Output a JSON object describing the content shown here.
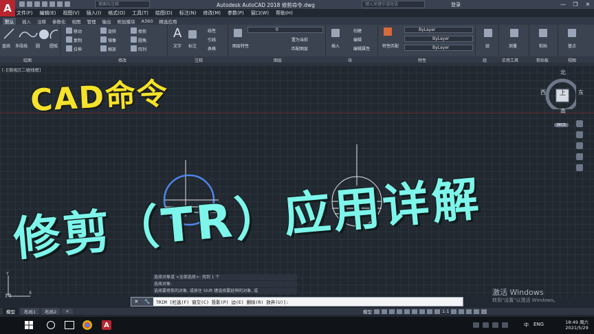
{
  "titlebar": {
    "workspace": "草图与注释",
    "title": "Autodesk AutoCAD 2018    修剪命令.dwg",
    "search_placeholder": "键入关键字或短语",
    "login": "登录",
    "min": "—",
    "max": "❐",
    "close": "✕"
  },
  "menu": [
    "文件(F)",
    "编辑(E)",
    "视图(V)",
    "插入(I)",
    "格式(O)",
    "工具(T)",
    "绘图(D)",
    "标注(N)",
    "修改(M)",
    "参数(P)",
    "窗口(W)",
    "帮助(H)"
  ],
  "ribbon_tabs": [
    "默认",
    "插入",
    "注释",
    "参数化",
    "视图",
    "管理",
    "输出",
    "附加模块",
    "A360",
    "精选应用"
  ],
  "ribbon": {
    "draw": [
      "直线",
      "多段线",
      "圆",
      "圆弧"
    ],
    "modify": [
      "移动",
      "旋转",
      "修剪",
      "复制",
      "镜像",
      "圆角",
      "拉伸",
      "缩放",
      "阵列"
    ],
    "annot": [
      "文字",
      "标注",
      "线性",
      "引线",
      "表格"
    ],
    "layers": [
      "图层特性",
      "0",
      "置为当前",
      "匹配图层"
    ],
    "block": [
      "插入",
      "创建",
      "编辑",
      "编辑属性"
    ],
    "props": [
      "特性匹配",
      "ByLayer",
      "ByLayer",
      "ByLayer"
    ],
    "groups": [
      "组"
    ],
    "utils": [
      "测量"
    ],
    "clipboard": [
      "粘贴"
    ],
    "base": [
      "基点"
    ]
  },
  "panel_labels": [
    "绘图",
    "修改",
    "注释",
    "图层",
    "块",
    "特性",
    "组",
    "实用工具",
    "剪贴板",
    "视图"
  ],
  "viewport": {
    "label": "[-][俯视][二维线框]",
    "compass_n": "北",
    "compass_s": "南",
    "compass_e": "东",
    "compass_w": "西",
    "compass_top": "上",
    "wcs": "WCS"
  },
  "overlay": {
    "title_line1": "CAD命令",
    "title_line2": "修剪（TR）应用详解"
  },
  "command": {
    "history": [
      "选择对象或 <全部选择>:  找到 1 个",
      "选择对象:",
      "选择要修剪的对象, 或按住 Shift 键选择要延伸的对象, 或"
    ],
    "prompt": "TRIM [栏选(F) 窗交(C) 投影(P) 边(E) 删除(R) 放弃(U)]:"
  },
  "layout_tabs": [
    "模型",
    "布局1",
    "布局2",
    "+"
  ],
  "status": {
    "model": "模型",
    "scale": "1:1"
  },
  "watermark": {
    "line1": "激活 Windows",
    "line2": "转到\"设置\"以激活 Windows。"
  },
  "taskbar": {
    "time": "18:49 周六",
    "date": "2021/5/29",
    "ime": "ENG",
    "ime2": "中"
  }
}
